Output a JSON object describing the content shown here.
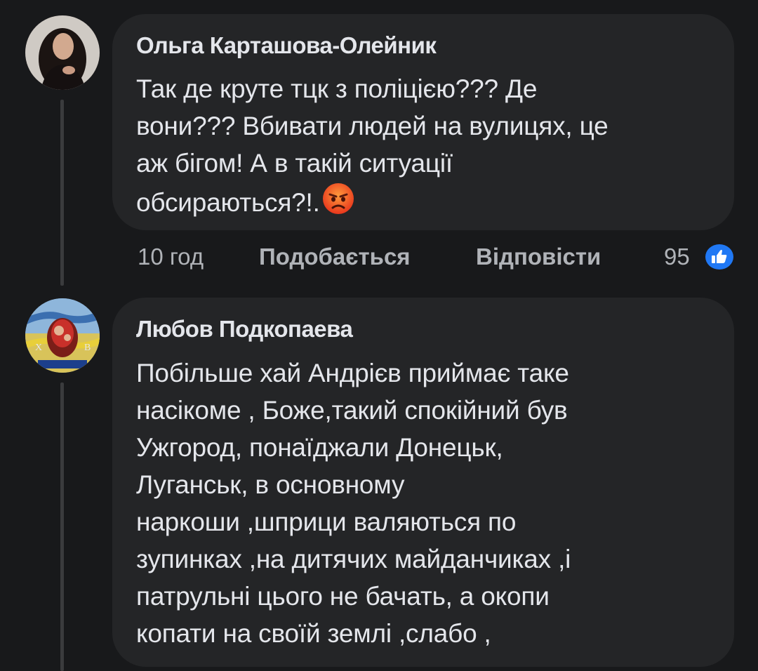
{
  "comments": [
    {
      "author": "Ольга Карташова-Олейник",
      "lines": [
        "Так де круте тцк з поліцією??? Де",
        "вони??? Вбивати людей на вулицях, це",
        "аж бігом! А в такій ситуації",
        "обсираються?!."
      ],
      "emoji": "angry-face-emoji",
      "time": "10 год",
      "like_label": "Подобається",
      "reply_label": "Відповісти",
      "reaction_count": "95",
      "reaction_icon": "like-icon"
    },
    {
      "author": "Любов Подкопаева",
      "lines": [
        "Побільше хай Андрієв приймає таке",
        "насікоме , Боже,такий спокійний був",
        "Ужгород, понаїджали Донецьк,",
        "Луганськ, в основному",
        "наркоши ,шприци валяються по",
        "зупинках ,на дитячих майданчиках ,і",
        "патрульні цього не бачать, а окопи",
        "копати на своїй землі ,слабо ,"
      ]
    }
  ],
  "colors": {
    "background": "#18191b",
    "bubble": "#242527",
    "text": "#e4e6eb",
    "meta": "#b0b3b8",
    "like_blue": "#2078f4"
  }
}
